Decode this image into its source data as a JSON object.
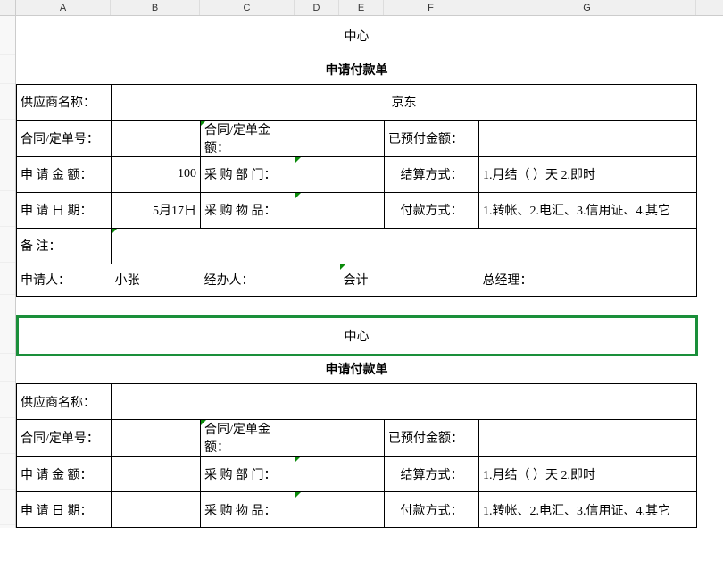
{
  "columns": [
    "A",
    "B",
    "C",
    "D",
    "E",
    "F",
    "G"
  ],
  "form1": {
    "title": "中心",
    "subtitle": "申请付款单",
    "supplier_label": "供应商名称：",
    "supplier_value": "京东",
    "contract_no_label": "合同/定单号：",
    "contract_no_value": "",
    "contract_amt_label": "合同/定单金额：",
    "contract_amt_value": "",
    "prepaid_label": "已预付金额：",
    "prepaid_value": "",
    "apply_amt_label": "申 请 金 额：",
    "apply_amt_value": "100",
    "dept_label": "采 购 部 门：",
    "dept_value": "",
    "settle_label": "结算方式：",
    "settle_value": "1.月结（ ）天   2.即时",
    "apply_date_label": "申 请 日 期：",
    "apply_date_value": "5月17日",
    "goods_label": "采 购 物 品：",
    "goods_value": "",
    "pay_method_label": "付款方式：",
    "pay_method_value": "1.转帐、2.电汇、3.信用证、4.其它",
    "remark_label": "备     注：",
    "remark_value": "",
    "applicant_label": "申请人：",
    "applicant_value": "小张",
    "handler_label": "经办人：",
    "accountant_label": "会计",
    "manager_label": "总经理："
  },
  "form2": {
    "title": "中心",
    "subtitle": "申请付款单",
    "supplier_label": "供应商名称：",
    "supplier_value": "",
    "contract_no_label": "合同/定单号：",
    "contract_no_value": "",
    "contract_amt_label": "合同/定单金额：",
    "contract_amt_value": "",
    "prepaid_label": "已预付金额：",
    "prepaid_value": "",
    "apply_amt_label": "申 请 金 额：",
    "apply_amt_value": "",
    "dept_label": "采 购 部 门：",
    "dept_value": "",
    "settle_label": "结算方式：",
    "settle_value": "1.月结（ ）天   2.即时",
    "apply_date_label": "申 请 日 期：",
    "apply_date_value": "",
    "goods_label": "采 购 物 品：",
    "goods_value": "",
    "pay_method_label": "付款方式：",
    "pay_method_value": "1.转帐、2.电汇、3.信用证、4.其它"
  }
}
